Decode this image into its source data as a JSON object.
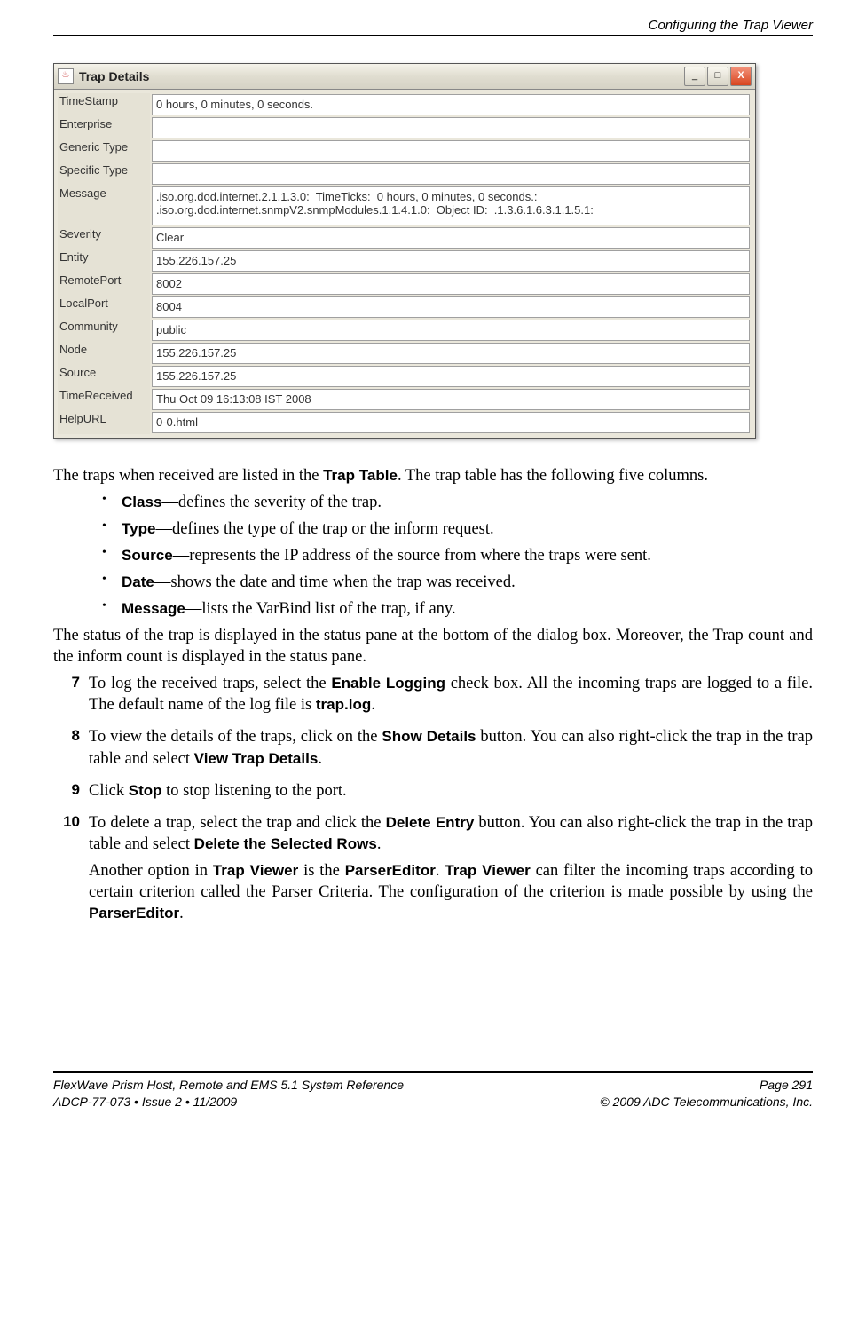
{
  "header": {
    "section_title": "Configuring the Trap Viewer"
  },
  "dialog": {
    "title": "Trap Details",
    "rows": [
      {
        "label": "TimeStamp",
        "value": "0 hours, 0 minutes, 0 seconds.",
        "multiline": false
      },
      {
        "label": "Enterprise",
        "value": "",
        "multiline": false
      },
      {
        "label": "Generic Type",
        "value": "",
        "multiline": false
      },
      {
        "label": "Specific Type",
        "value": "",
        "multiline": false
      },
      {
        "label": "Message",
        "value": ".iso.org.dod.internet.2.1.1.3.0:  TimeTicks:  0 hours, 0 minutes, 0 seconds.:\n.iso.org.dod.internet.snmpV2.snmpModules.1.1.4.1.0:  Object ID:  .1.3.6.1.6.3.1.1.5.1:",
        "multiline": true
      },
      {
        "label": "Severity",
        "value": "Clear",
        "multiline": false
      },
      {
        "label": "Entity",
        "value": "155.226.157.25",
        "multiline": false
      },
      {
        "label": "RemotePort",
        "value": "8002",
        "multiline": false
      },
      {
        "label": "LocalPort",
        "value": "8004",
        "multiline": false
      },
      {
        "label": "Community",
        "value": "public",
        "multiline": false
      },
      {
        "label": "Node",
        "value": "155.226.157.25",
        "multiline": false
      },
      {
        "label": "Source",
        "value": "155.226.157.25",
        "multiline": false
      },
      {
        "label": "TimeReceived",
        "value": "Thu Oct 09 16:13:08 IST 2008",
        "multiline": false
      },
      {
        "label": "HelpURL",
        "value": "0-0.html",
        "multiline": false
      }
    ]
  },
  "body": {
    "intro_pre": "The traps when received are listed in the ",
    "intro_bold": "Trap Table",
    "intro_post": ". The trap table has the following five columns.",
    "bullets": [
      {
        "term": "Class",
        "desc": "—defines the severity of the trap."
      },
      {
        "term": "Type",
        "desc": "—defines the type of the trap or the inform request."
      },
      {
        "term": "Source",
        "desc": "—represents the IP address of the source from where the traps were sent."
      },
      {
        "term": "Date",
        "desc": "—shows the date and time when the trap was received."
      },
      {
        "term": "Message",
        "desc": "—lists the VarBind list of the trap, if any."
      }
    ],
    "status_para": "The status of the trap is displayed in the status pane at the bottom of the dialog box. Moreover, the Trap count and the inform count is displayed in the status pane.",
    "steps": {
      "s7": {
        "num": "7",
        "t1": "To log the received traps, select the ",
        "b1": "Enable Logging",
        "t2": " check box. All the incoming traps are logged to a file. The default name of the log file is ",
        "b2": "trap.log",
        "t3": "."
      },
      "s8": {
        "num": "8",
        "t1": "To view the details of the traps, click on the ",
        "b1": "Show Details",
        "t2": " button. You can also right-click the trap in the trap table and select ",
        "b2": "View Trap Details",
        "t3": "."
      },
      "s9": {
        "num": "9",
        "t1": "Click ",
        "b1": "Stop",
        "t2": " to stop listening to the port."
      },
      "s10": {
        "num": "10",
        "t1": "To delete a trap, select the trap and click the ",
        "b1": "Delete Entry",
        "t2": " button. You can also right-click the trap in the trap table and select ",
        "b2": "Delete the Selected Rows",
        "t3": ".",
        "p2_t1": "Another option in ",
        "p2_b1": "Trap Viewer",
        "p2_t2": " is the ",
        "p2_b2": "ParserEditor",
        "p2_t3": ". ",
        "p2_b3": "Trap Viewer",
        "p2_t4": " can filter the incoming traps according to certain criterion called the Parser Criteria. The configuration of the criterion is made possible by using the ",
        "p2_b4": "ParserEditor",
        "p2_t5": "."
      }
    }
  },
  "footer": {
    "left1": "FlexWave Prism Host, Remote and EMS 5.1 System Reference",
    "left2": "ADCP-77-073  •  Issue 2  •  11/2009",
    "right1": "Page 291",
    "right2": "© 2009 ADC Telecommunications, Inc."
  }
}
